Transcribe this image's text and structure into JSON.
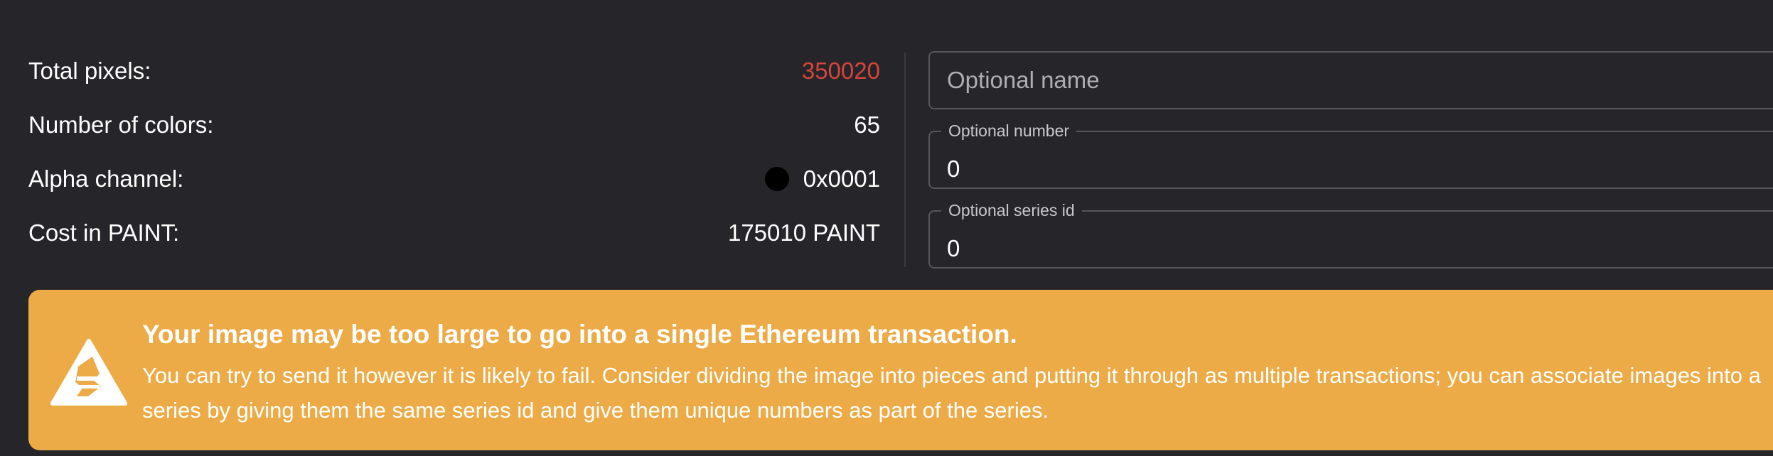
{
  "stats": [
    {
      "label": "Total pixels:",
      "value": "350020",
      "status": "over-limit"
    },
    {
      "label": "Number of colors:",
      "value": "65"
    },
    {
      "label": "Alpha channel:",
      "value": "0x0001",
      "swatch_color": "#000000"
    },
    {
      "label": "Cost in PAINT:",
      "value": "175010 PAINT"
    }
  ],
  "form": {
    "name_placeholder": "Optional name",
    "name_value": "",
    "number_label": "Optional number",
    "number_value": "0",
    "series_label": "Optional series id",
    "series_value": "0"
  },
  "banner": {
    "icon": "warning-triangle-icon",
    "title": "Your image may be too large to go into a single Ethereum transaction.",
    "body": "You can try to send it however it is likely to fail. Consider dividing the image into pieces and putting it through as multiple transactions; you can associate images into a series by giving them the same series id and give them unique numbers as part of the series."
  },
  "colors": {
    "background": "#262529",
    "warning_value": "#d4453d",
    "banner_background": "#ecab46",
    "field_border": "#57565c"
  }
}
